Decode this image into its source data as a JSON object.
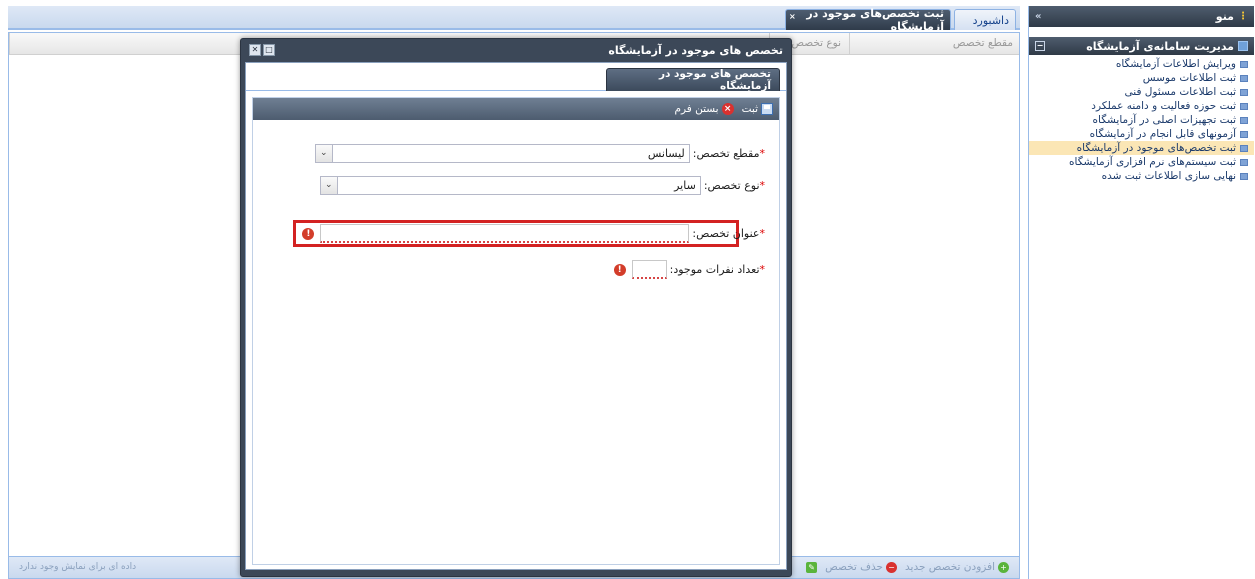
{
  "sidebar": {
    "title": "منو",
    "group_title": "مدیریت سامانه‌ی آزمایشگاه",
    "items": [
      {
        "label": "ویرایش اطلاعات آزمایشگاه",
        "active": false
      },
      {
        "label": "ثبت اطلاعات موسس",
        "active": false
      },
      {
        "label": "ثبت اطلاعات مسئول فنی",
        "active": false
      },
      {
        "label": "ثبت حوزه فعالیت و دامنه عملکرد",
        "active": false
      },
      {
        "label": "ثبت تجهیزات اصلی در آزمایشگاه",
        "active": false
      },
      {
        "label": "آزمونهای قابل انجام در آزمایشگاه",
        "active": false
      },
      {
        "label": "ثبت تخصص‌های موجود در آزمایشگاه",
        "active": true
      },
      {
        "label": "ثبت سیستم‌های نرم افزاری آزمایشگاه",
        "active": false
      },
      {
        "label": "نهایی سازی اطلاعات ثبت شده",
        "active": false
      }
    ]
  },
  "tabs": {
    "dashboard": "داشبورد",
    "active": "ثبت تخصص‌های موجود در آزمایشگاه"
  },
  "grid": {
    "columns": [
      "مقطع تخصص",
      "نوع تخصص"
    ],
    "empty_text": "داده ای برای نمایش وجود ندارد",
    "add_label": "افزودن تخصص جدید",
    "delete_label": "حذف تخصص"
  },
  "modal": {
    "title": "تخصص های موجود در آزمایشگاه",
    "tab_label": "تخصص های موجود در آزمایشگاه",
    "save_label": "ثبت",
    "close_form_label": "بستن فرم",
    "fields": {
      "degree_label": "مقطع تخصص:",
      "degree_value": "لیسانس",
      "type_label": "نوع تخصص:",
      "type_value": "سایر",
      "title_label": "عنوان تخصص:",
      "title_value": "",
      "count_label": "تعداد نفرات موجود:",
      "count_value": ""
    }
  },
  "colors": {
    "accent": "#3c4858",
    "highlight_border": "#d32222",
    "active_item_bg": "#fbe6b5"
  }
}
